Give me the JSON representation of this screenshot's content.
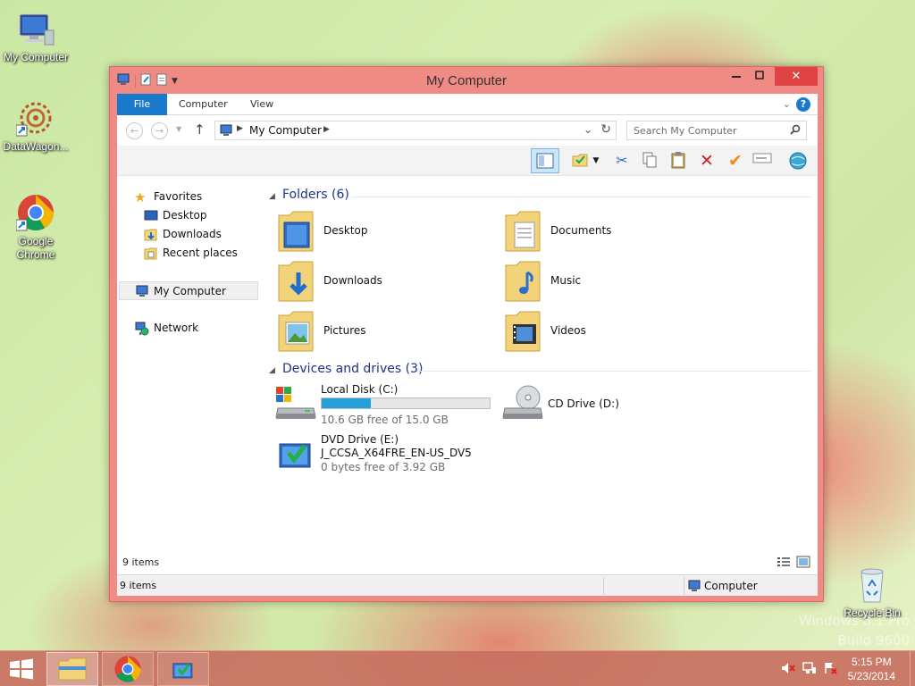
{
  "desktop": {
    "icons": [
      {
        "label": "My Computer"
      },
      {
        "label": "DataWagon..."
      },
      {
        "label": "Google Chrome"
      },
      {
        "label": "Recycle Bin"
      }
    ],
    "watermark_line1": "Windows 8.1 Pro",
    "watermark_line2": "Build 9600"
  },
  "window": {
    "title": "My Computer",
    "ribbon_tabs": [
      "File",
      "Computer",
      "View"
    ],
    "address_crumb": "My Computer",
    "search_placeholder": "Search My Computer"
  },
  "nav_pane": {
    "favorites": "Favorites",
    "desktop": "Desktop",
    "downloads": "Downloads",
    "recent": "Recent places",
    "my_computer": "My Computer",
    "network": "Network"
  },
  "content": {
    "folders_header": "Folders (6)",
    "folders": [
      "Desktop",
      "Documents",
      "Downloads",
      "Music",
      "Pictures",
      "Videos"
    ],
    "devices_header": "Devices and drives (3)",
    "drives": [
      {
        "name": "Local Disk (C:)",
        "free": "10.6 GB free of 15.0 GB",
        "used_fraction": 0.293
      },
      {
        "name": "CD Drive (D:)"
      },
      {
        "name": "DVD Drive (E:)",
        "label": "J_CCSA_X64FRE_EN-US_DV5",
        "free": "0 bytes free of 3.92 GB"
      }
    ]
  },
  "status": {
    "items_inner": "9 items",
    "items_bar": "9 items",
    "location": "Computer"
  },
  "taskbar": {
    "time": "5:15 PM",
    "date": "5/23/2014"
  },
  "colors": {
    "accent": "#1979ca",
    "window_frame": "#f08a84",
    "header_text": "#1e3287",
    "drive_bar": "#26a0da"
  }
}
